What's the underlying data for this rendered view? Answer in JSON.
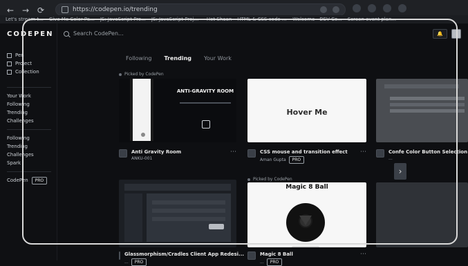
{
  "browser": {
    "url": "https://codepen.io/trending",
    "bookmarks": [
      "Let's stream t...",
      "Give Me Color Pa...",
      "JS: JavaScript Pro...",
      "JS: JavaScript Proje...",
      "Hot Shaan",
      "HTML & CSS code s...",
      "Welcome - DEV Co...",
      "Screen event plan..."
    ]
  },
  "app": {
    "logo": "CODEPEN",
    "search_placeholder": "Search CodePen...",
    "sidebar": {
      "main_items": [
        "Pen",
        "Project",
        "Collection"
      ],
      "groups": [
        [
          "Your Work",
          "Following",
          "Trending",
          "Challenges"
        ],
        [
          "Following",
          "Trending",
          "Challenges",
          "Spark"
        ]
      ],
      "pro_label": "CodePen",
      "pro_badge": "PRO"
    },
    "tabs": [
      "Following",
      "Trending",
      "Your Work"
    ],
    "active_tab": "Trending",
    "pick_label": "Picked by CodePen",
    "cards": [
      {
        "preview_title": "ANTI-GRAVITY ROOM",
        "title": "Anti Gravity Room",
        "subtitle": "ANKU-001"
      },
      {
        "preview_text": "Hover Me",
        "title": "CSS mouse and transition effect",
        "subtitle": "Aman Gupta",
        "badge": "PRO"
      },
      {
        "title": "Confe Color Button Selection",
        "subtitle": "..."
      },
      {
        "title": "Glassmorphism/Cradles Client App Redesi...",
        "subtitle": "...",
        "badge": "PRO"
      },
      {
        "preview_title": "Magic 8 Ball",
        "title": "Magic 8 Ball",
        "subtitle": "...",
        "badge": "PRO"
      }
    ]
  },
  "colors": {
    "accent_frame": "#d9d9d9"
  }
}
